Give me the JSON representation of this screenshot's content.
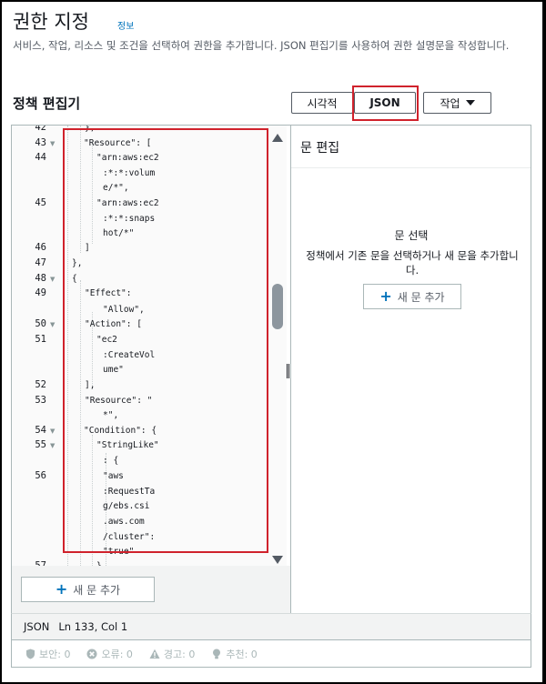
{
  "header": {
    "title": "권한 지정",
    "info_link": "정보",
    "description": "서비스, 작업, 리소스 및 조건을 선택하여 권한을 추가합니다. JSON 편집기를 사용하여 권한 설명문을 작성합니다."
  },
  "editor": {
    "title": "정책 편집기",
    "tabs": {
      "visual": "시각적",
      "json": "JSON",
      "actions": "작업"
    }
  },
  "code": {
    "lines": [
      {
        "n": "42",
        "text": "},",
        "fold": false
      },
      {
        "n": "43",
        "text": "\"Resource\": [",
        "fold": true
      },
      {
        "n": "44",
        "text": "\"arn:aws:ec2",
        "fold": false
      },
      {
        "n": "",
        "text": ":*:*:volum",
        "fold": false
      },
      {
        "n": "",
        "text": "e/*\",",
        "fold": false
      },
      {
        "n": "45",
        "text": "\"arn:aws:ec2",
        "fold": false
      },
      {
        "n": "",
        "text": ":*:*:snaps",
        "fold": false
      },
      {
        "n": "",
        "text": "hot/*\"",
        "fold": false
      },
      {
        "n": "46",
        "text": "]",
        "fold": false
      },
      {
        "n": "47",
        "text": "},",
        "fold": false
      },
      {
        "n": "48",
        "text": "{",
        "fold": true
      },
      {
        "n": "49",
        "text": "\"Effect\":",
        "fold": false
      },
      {
        "n": "",
        "text": "\"Allow\",",
        "fold": false
      },
      {
        "n": "50",
        "text": "\"Action\": [",
        "fold": true
      },
      {
        "n": "51",
        "text": "\"ec2",
        "fold": false
      },
      {
        "n": "",
        "text": ":CreateVol",
        "fold": false
      },
      {
        "n": "",
        "text": "ume\"",
        "fold": false
      },
      {
        "n": "52",
        "text": "],",
        "fold": false
      },
      {
        "n": "53",
        "text": "\"Resource\": \"",
        "fold": false
      },
      {
        "n": "",
        "text": "*\",",
        "fold": false
      },
      {
        "n": "54",
        "text": "\"Condition\": {",
        "fold": true
      },
      {
        "n": "55",
        "text": "\"StringLike\"",
        "fold": true
      },
      {
        "n": "",
        "text": ": {",
        "fold": false
      },
      {
        "n": "56",
        "text": "\"aws",
        "fold": false
      },
      {
        "n": "",
        "text": ":RequestTa",
        "fold": false
      },
      {
        "n": "",
        "text": "g/ebs.csi",
        "fold": false
      },
      {
        "n": "",
        "text": ".aws.com",
        "fold": false
      },
      {
        "n": "",
        "text": "/cluster\":",
        "fold": false
      },
      {
        "n": "",
        "text": "\"true\"",
        "fold": false
      },
      {
        "n": "57",
        "text": "}",
        "fold": false
      }
    ]
  },
  "panel": {
    "title": "문 편집",
    "select_title": "문 선택",
    "select_desc": "정책에서 기존 문을 선택하거나 새 문을 추가합니다.",
    "add_button": "새 문 추가"
  },
  "left_add_button": "새 문 추가",
  "status": {
    "mode": "JSON",
    "position": "Ln 133, Col 1"
  },
  "validation": [
    {
      "icon": "shield-icon",
      "label": "보안: 0"
    },
    {
      "icon": "error-icon",
      "label": "오류: 0"
    },
    {
      "icon": "warning-icon",
      "label": "경고: 0"
    },
    {
      "icon": "suggestion-icon",
      "label": "추천: 0"
    }
  ]
}
